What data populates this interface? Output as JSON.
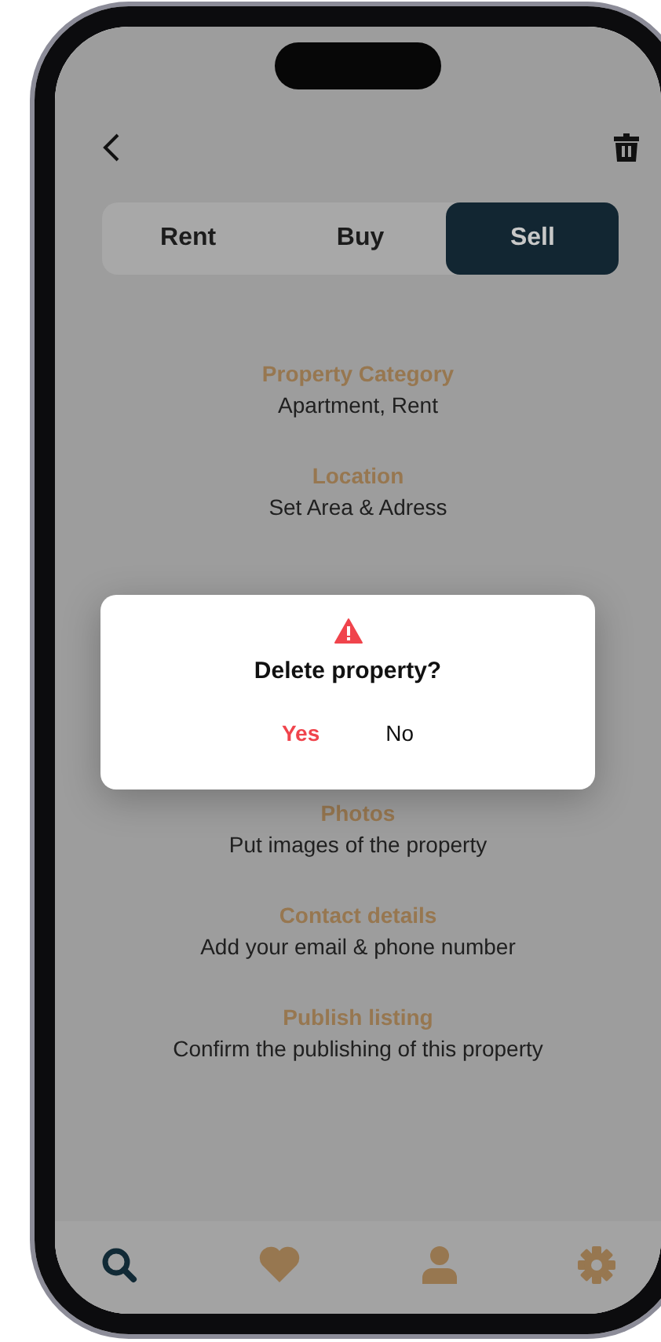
{
  "tabs": [
    {
      "label": "Rent",
      "selected": false
    },
    {
      "label": "Buy",
      "selected": false
    },
    {
      "label": "Sell",
      "selected": true
    }
  ],
  "sections": [
    {
      "title": "Property Category",
      "subtitle": "Apartment, Rent"
    },
    {
      "title": "Location",
      "subtitle": "Set Area & Adress"
    },
    {
      "title": "Photos",
      "subtitle": "Put images of the property"
    },
    {
      "title": "Contact details",
      "subtitle": "Add your email & phone number"
    },
    {
      "title": "Publish listing",
      "subtitle": "Confirm the publishing of this property"
    }
  ],
  "dialog": {
    "title": "Delete property?",
    "buttons": [
      {
        "label": "Yes",
        "kind": "destructive"
      },
      {
        "label": "No",
        "kind": "default"
      }
    ]
  },
  "bottom_nav": [
    {
      "kind": "search",
      "selected": true
    },
    {
      "kind": "favorites",
      "selected": false
    },
    {
      "kind": "profile",
      "selected": false
    },
    {
      "kind": "settings",
      "selected": false
    }
  ]
}
